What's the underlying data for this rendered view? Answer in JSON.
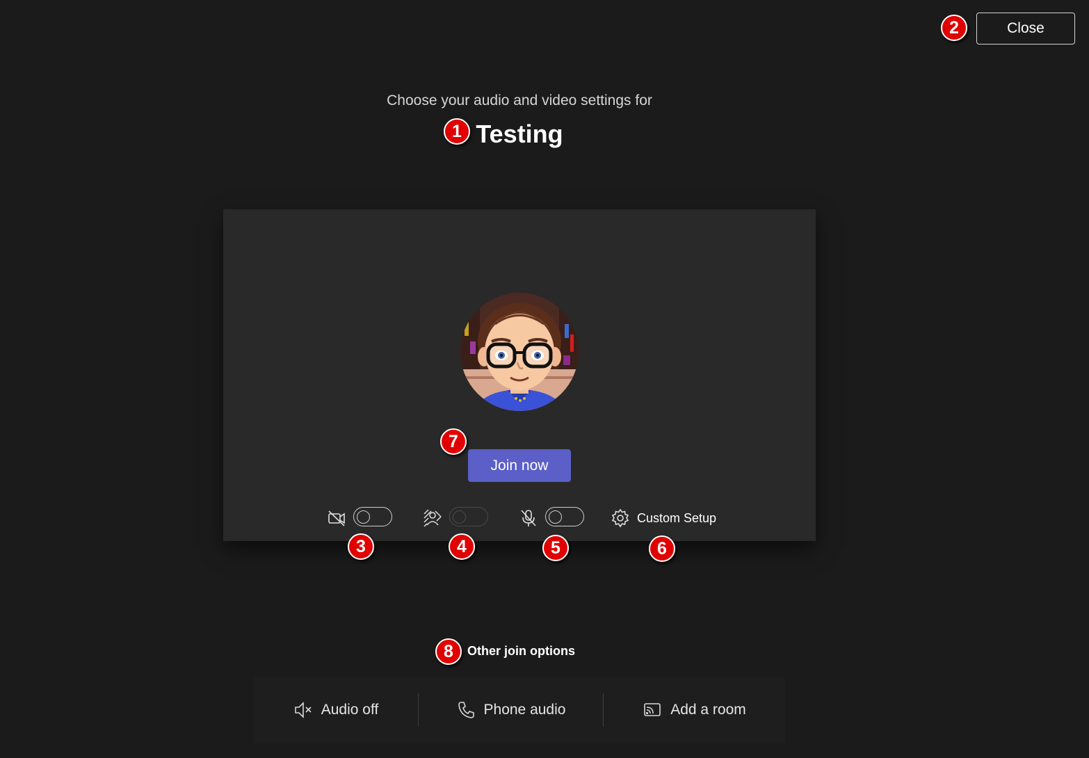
{
  "header": {
    "close_label": "Close",
    "subtitle": "Choose your audio and video settings for",
    "meeting_title": "Testing"
  },
  "preview": {
    "avatar_alt": "user-avatar",
    "join_label": "Join now",
    "controls": {
      "camera": {
        "icon": "camera-off-icon",
        "state": "off"
      },
      "background": {
        "icon": "background-effects-icon",
        "state": "off",
        "enabled": false
      },
      "microphone": {
        "icon": "mic-off-icon",
        "state": "off"
      },
      "custom_setup_label": "Custom Setup",
      "custom_setup_icon": "gear-icon"
    }
  },
  "other_options": {
    "heading": "Other join options",
    "items": [
      {
        "label": "Audio off",
        "icon": "speaker-muted-icon"
      },
      {
        "label": "Phone audio",
        "icon": "phone-icon"
      },
      {
        "label": "Add a room",
        "icon": "cast-icon"
      }
    ]
  },
  "annotations": [
    "1",
    "2",
    "3",
    "4",
    "5",
    "6",
    "7",
    "8"
  ],
  "colors": {
    "background": "#1b1b1b",
    "panel": "#292929",
    "accent": "#5b5fc7",
    "badge": "#e00000"
  }
}
